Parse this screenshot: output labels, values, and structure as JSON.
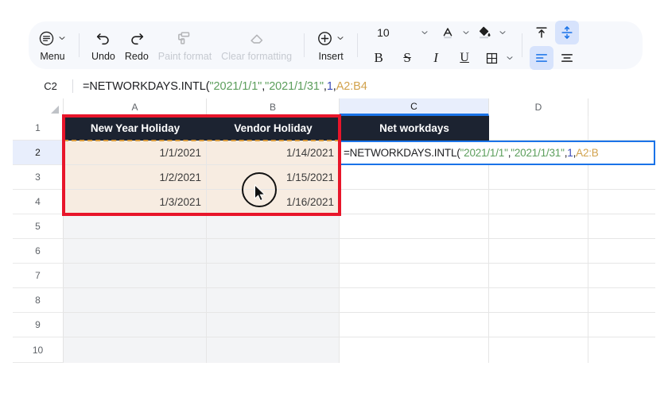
{
  "app": {
    "name_box_value": "C2"
  },
  "toolbar": {
    "menu_label": "Menu",
    "undo_label": "Undo",
    "redo_label": "Redo",
    "paint_format_label": "Paint format",
    "clear_formatting_label": "Clear formatting",
    "insert_label": "Insert",
    "font_size_value": "10",
    "bold_label": "B",
    "strikethrough_label": "S",
    "italic_label": "I",
    "underline_label": "U",
    "icons": {
      "menu": "menu-circle-icon",
      "undo": "undo-arrow-icon",
      "redo": "redo-arrow-icon",
      "paint_format": "paint-roller-icon",
      "clear_formatting": "eraser-icon",
      "insert": "plus-circle-icon",
      "text_color": "text-color-a-icon",
      "fill_color": "fill-bucket-icon",
      "borders": "borders-grid-icon",
      "align_top": "align-top-icon",
      "align_middle": "align-middle-icon",
      "align_left": "align-left-icon",
      "align_center": "align-center-icon",
      "chevron": "chevron-down-icon"
    },
    "colors": {
      "toolbar_bg": "#f6f8fc",
      "active_bg": "#d7e3fc",
      "active_fg": "#1a73e8",
      "disabled_fg": "#c6cad1"
    }
  },
  "formula": {
    "prefix": "=NETWORKDAYS.INTL",
    "open_paren": "(",
    "arg1": "\"2021/1/1\"",
    "comma1": ",",
    "arg2": "\"2021/1/31\"",
    "comma2": ",",
    "arg3": "1",
    "comma3": ",",
    "arg4": "A2:B4",
    "cell_arg4": "A2:B",
    "colors": {
      "string": "#5c9e5c",
      "number": "#3a4ab8",
      "range": "#d2a24c",
      "plain": "#202124"
    }
  },
  "sheet": {
    "column_headers": [
      "A",
      "B",
      "C",
      "D"
    ],
    "selected_column": "C",
    "row_headers": [
      "1",
      "2",
      "3",
      "4",
      "5",
      "6",
      "7",
      "8",
      "9",
      "10"
    ],
    "selected_row": "2",
    "header_row": {
      "a": "New Year Holiday",
      "b": "Vendor Holiday",
      "c": "Net workdays"
    },
    "rows": [
      {
        "a": "1/1/2021",
        "b": "1/14/2021"
      },
      {
        "a": "1/2/2021",
        "b": "1/15/2021"
      },
      {
        "a": "1/3/2021",
        "b": "1/16/2021"
      }
    ],
    "colors": {
      "header_cell_bg": "#1c2331",
      "header_cell_fg": "#ffffff",
      "data_cell_bg": "#f7ece1",
      "tinted_bg": "#f3f4f6",
      "selection_highlight": "#e8152a",
      "marching_ants": "#d99a3a",
      "active_cell_border": "#1a73e8",
      "header_highlight_bg": "#e8eefc"
    }
  },
  "annotations": {
    "red_box_label": "highlight-box-a1-b4",
    "cursor_label": "mouse-cursor-highlight"
  }
}
